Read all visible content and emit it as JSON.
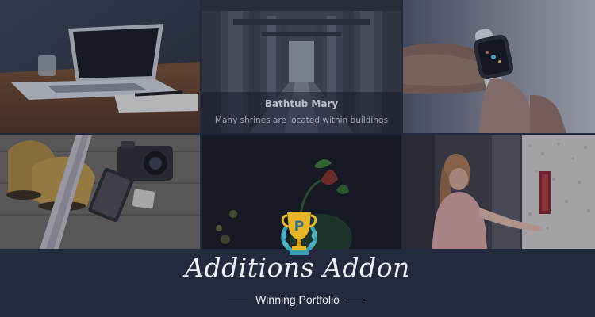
{
  "portfolio": {
    "tiles": [
      {
        "subject": "laptop-on-desk"
      },
      {
        "subject": "shrine-corridor"
      },
      {
        "subject": "smartwatch-on-wrist"
      },
      {
        "subject": "boots-tie-camera-flatlay"
      },
      {
        "subject": "dark-apple-plant"
      },
      {
        "subject": "woman-in-hallway"
      }
    ],
    "hover_caption": {
      "title": "Bathtub Mary",
      "subtitle": "Many shrines are located within buildings"
    }
  },
  "brand": {
    "title": "Additions Addon",
    "tagline": "Winning Portfolio",
    "badge_letter": "P"
  },
  "colors": {
    "background": "#232a3d",
    "trophy_gold": "#e8b52a",
    "trophy_teal": "#3a9fb0",
    "text_light": "#f1f2f6"
  }
}
